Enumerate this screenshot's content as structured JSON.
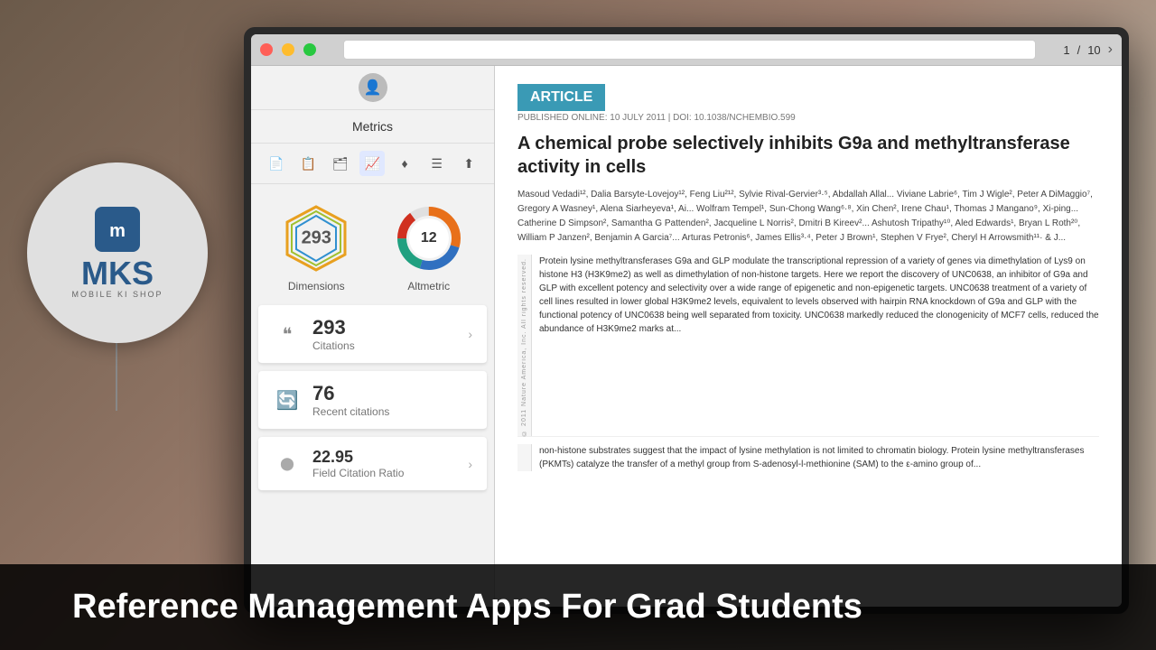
{
  "desktop": {
    "background_desc": "wooden desk background"
  },
  "logo": {
    "brand": "MKS",
    "subtitle": "MOBILE KI SHOP",
    "icon_symbol": "m"
  },
  "top_bar": {
    "close_label": "×",
    "nav_current": "1",
    "nav_total": "10",
    "nav_separator": "/",
    "nav_arrow": "›"
  },
  "metrics_panel": {
    "title": "Metrics",
    "toolbar_icons": [
      "doc",
      "copy",
      "layers",
      "chart",
      "diamond",
      "list",
      "upload"
    ],
    "dimensions": {
      "value": "293",
      "label": "Dimensions"
    },
    "altmetric": {
      "value": "12",
      "label": "Altmetric"
    },
    "citations": {
      "number": "293",
      "label": "Citations",
      "arrow": "›"
    },
    "recent_citations": {
      "number": "76",
      "label": "Recent citations",
      "arrow": ""
    },
    "field_citation_ratio": {
      "number": "22.95",
      "label": "Field Citation Ratio",
      "arrow": "›"
    }
  },
  "article": {
    "badge": "ARTICLE",
    "published_line": "PUBLISHED ONLINE: 10 JULY 2011 | DOI: 10.1038/NCHEMBIO.599",
    "title": "A chemical probe selectively inhibits G9a and methyltransferase activity in cells",
    "authors": "Masoud Vedadi¹², Dalia Barsyte-Lovejoy¹², Feng Liu²¹², Sylvie Rival-Gervier³·⁵, Abdallah Allal... Viviane Labrie⁶, Tim J Wigle², Peter A DiMaggio⁷, Gregory A Wasney¹, Alena Siarheyeva¹, Ai... Wolfram Tempel¹, Sun-Chong Wang⁶·⁸, Xin Chen², Irene Chau¹, Thomas J Mangano⁹, Xi-ping... Catherine D Simpson², Samantha G Pattenden², Jacqueline L Norris², Dmitri B Kireev²... Ashutosh Tripathy¹⁰, Aled Edwards¹, Bryan L Roth²⁰, William P Janzen², Benjamin A Garcia⁷... Arturas Petronis⁶, James Ellis³·⁴, Peter J Brown¹, Stephen V Frye², Cheryl H Arrowsmith¹¹· & J...",
    "abstract": "Protein lysine methyltransferases G9a and GLP modulate the transcriptional repression of a variety of genes via dimethylation of Lys9 on histone H3 (H3K9me2) as well as dimethylation of non-histone targets. Here we report the discovery of UNC0638, an inhibitor of G9a and GLP with excellent potency and selectivity over a wide range of epigenetic and non-epigenetic targets. UNC0638 treatment of a variety of cell lines resulted in lower global H3K9me2 levels, equivalent to levels observed with hairpin RNA knockdown of G9a and GLP with the functional potency of UNC0638 being well separated from toxicity. UNC0638 markedly reduced the clonogenicity of MCF7 cells, reduced the abundance of H3K9me2 marks at...",
    "rights_text": "© 2011 Nature America, Inc. All rights reserved.",
    "second_abstract": "non-histone substrates suggest that the impact of lysine methylation is not limited to chromatin biology. Protein lysine methyltransferases (PKMTs) catalyze the transfer of a methyl group from S-adenosyl-l-methionine (SAM) to the ε-amino group of..."
  },
  "banner": {
    "text": "Reference Management Apps For Grad Students"
  }
}
